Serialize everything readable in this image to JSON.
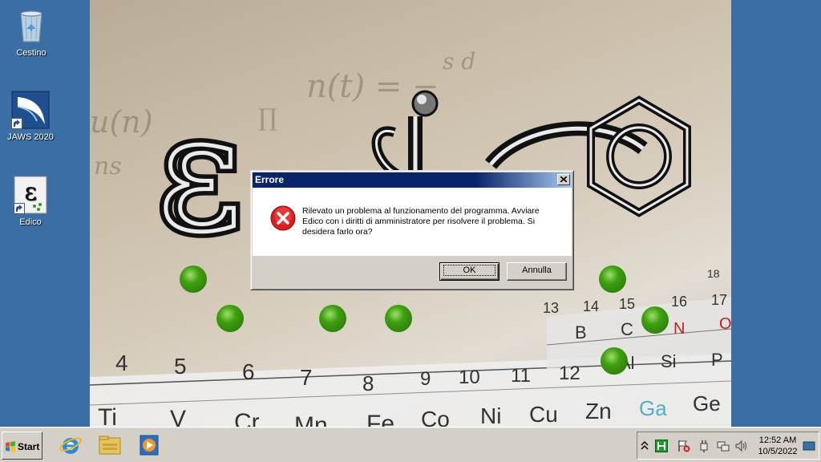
{
  "desktop": {
    "icons": [
      {
        "label": "Cestino"
      },
      {
        "label": "JAWS 2020"
      },
      {
        "label": "Edico"
      }
    ]
  },
  "splash": {
    "logo_text": "Edico",
    "table_numbers": [
      "4",
      "5",
      "6",
      "7",
      "8",
      "9",
      "10",
      "11",
      "12",
      "13",
      "14",
      "15",
      "16",
      "17",
      "18"
    ],
    "elements": [
      "Ti",
      "V",
      "Cr",
      "Mn",
      "Fe",
      "Co",
      "Ni",
      "Cu",
      "Zn",
      "Ga",
      "Ge",
      "B",
      "C",
      "N",
      "O",
      "Al",
      "Si",
      "P"
    ]
  },
  "dialog": {
    "title": "Errore",
    "message": "Rilevato un problema al funzionamento del programma. Avviare Edico con i diritti di amministratore per risolvere il problema. Si desidera farlo ora?",
    "ok_label": "OK",
    "cancel_label": "Annulla"
  },
  "taskbar": {
    "start_label": "Start",
    "pinned": [
      "internet-explorer-icon",
      "explorer-folder-icon",
      "media-player-icon"
    ],
    "clock_time": "12:52 AM",
    "clock_date": "10/5/2022"
  },
  "colors": {
    "desktop_bg": "#3a6ea5",
    "title_bar": "#0a246a",
    "dialog_face": "#d4d0c8",
    "error_red": "#d81e1e",
    "green_dot": "#3ea010"
  }
}
